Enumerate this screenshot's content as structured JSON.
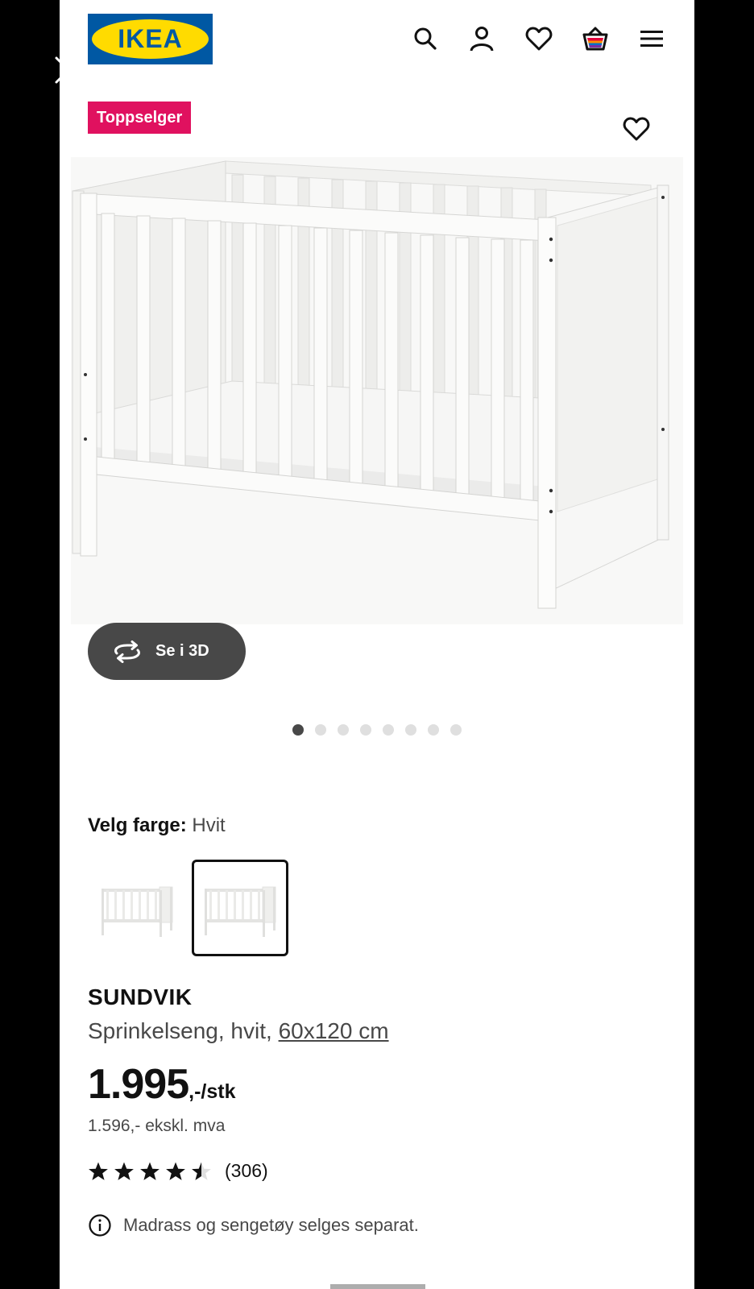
{
  "header": {
    "logo_text": "IKEA",
    "icons": [
      "search-icon",
      "account-icon",
      "heart-icon",
      "cart-icon",
      "menu-icon"
    ]
  },
  "badge": "Toppselger",
  "view_3d_label": "Se i 3D",
  "gallery": {
    "image_count": 8,
    "active_index": 0
  },
  "color": {
    "label": "Velg farge:",
    "value": "Hvit"
  },
  "product": {
    "name": "SUNDVIK",
    "description_prefix": "Sprinkelseng, hvit, ",
    "size_link": "60x120 cm",
    "price_main": "1.995",
    "price_suffix": ",-/stk",
    "price_ex_vat": "1.596,- ekskl. mva",
    "rating": 4.5,
    "review_count": "(306)",
    "notice": "Madrass og sengetøy selges separat."
  },
  "colors": {
    "badge": "#e0115f",
    "brand_blue": "#0058a3",
    "brand_yellow": "#ffdb00",
    "button_dark": "#484848"
  }
}
